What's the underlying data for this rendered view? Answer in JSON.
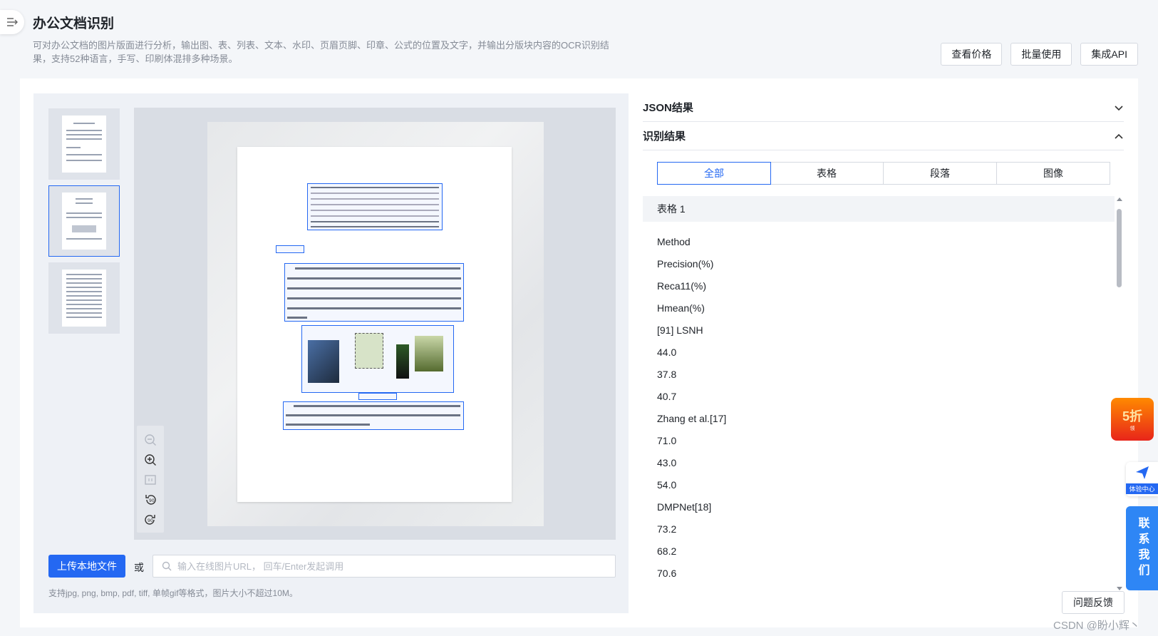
{
  "header": {
    "title": "办公文档识别",
    "description": "可对办公文档的图片版面进行分析，输出图、表、列表、文本、水印、页眉页脚、印章、公式的位置及文字，并输出分版块内容的OCR识别结果，支持52种语言，手写、印刷体混排多种场景。",
    "buttons": [
      "查看价格",
      "批量使用",
      "集成API"
    ]
  },
  "upload": {
    "button_label": "上传本地文件",
    "or_label": "或",
    "url_placeholder": "输入在线图片URL， 回车/Enter发起调用",
    "hint": "支持jpg, png, bmp, pdf, tiff, 单帧gif等格式，图片大小不超过10M。"
  },
  "results": {
    "json_section_title": "JSON结果",
    "recognition_section_title": "识别结果",
    "tabs": [
      {
        "label": "全部",
        "active": true
      },
      {
        "label": "表格",
        "active": false
      },
      {
        "label": "段落",
        "active": false
      },
      {
        "label": "图像",
        "active": false
      }
    ],
    "group_title": "表格 1",
    "cells": [
      "Method",
      "Precision(%)",
      "Reca11(%)",
      "Hmean(%)",
      "[91] LSNH",
      "44.0",
      "37.8",
      "40.7",
      "Zhang et al.[17]",
      "71.0",
      "43.0",
      "54.0",
      "DMPNet[18]",
      "73.2",
      "68.2",
      "70.6"
    ]
  },
  "feedback_label": "问题反馈",
  "watermark": "CSDN @盼小辉丶",
  "promo": {
    "big": "5折",
    "small": "领"
  },
  "experience_center_label": "体验中心",
  "contact_label": "联系我们",
  "colors": {
    "accent": "#2468f2",
    "contact": "#2e86f5"
  }
}
